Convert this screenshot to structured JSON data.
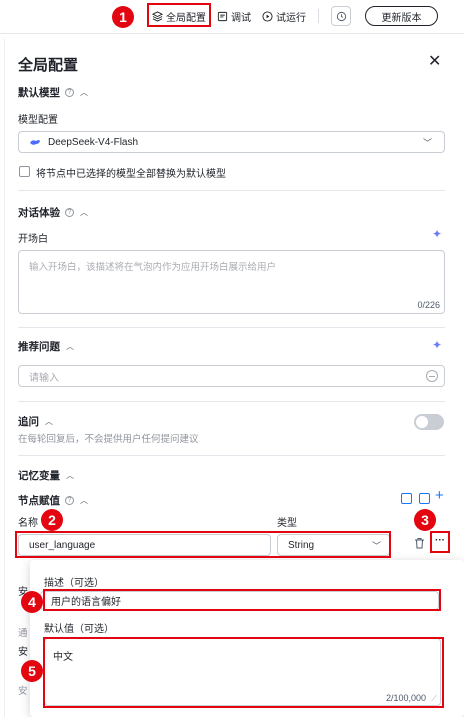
{
  "toolbar": {
    "global_config": "全局配置",
    "debug": "调试",
    "trial_run": "试运行",
    "update_version": "更新版本"
  },
  "annotations": [
    "1",
    "2",
    "3",
    "4",
    "5"
  ],
  "panel": {
    "title": "全局配置",
    "default_model": {
      "section_title": "默认模型",
      "label": "模型配置",
      "selected_model": "DeepSeek-V4-Flash",
      "replace_checkbox_label": "将节点中已选择的模型全部替换为默认模型"
    },
    "dialog_experience": {
      "section_title": "对话体验",
      "opening_label": "开场白",
      "opening_placeholder": "输入开场白，该描述将在气泡内作为应用开场白展示给用户",
      "opening_counter": "0/226"
    },
    "recommended": {
      "section_title": "推荐问题",
      "placeholder": "请输入"
    },
    "follow_up": {
      "section_title": "追问",
      "description": "在每轮回复后，不会提供用户任何提问建议"
    },
    "memory": {
      "section_title": "记忆变量"
    },
    "node_assign": {
      "section_title": "节点赋值",
      "col_name": "名称",
      "col_type": "类型",
      "row": {
        "name": "user_language",
        "type": "String"
      }
    },
    "partial_labels": {
      "a": "安",
      "b": "通",
      "c": "安",
      "d": "安"
    }
  },
  "popup": {
    "desc_label": "描述（可选）",
    "desc_value": "用户的语言偏好",
    "default_label": "默认值（可选）",
    "default_value": "中文",
    "counter": "2/100,000"
  },
  "colors": {
    "accent": "#1677ff",
    "annotation_red": "#e3050f"
  }
}
